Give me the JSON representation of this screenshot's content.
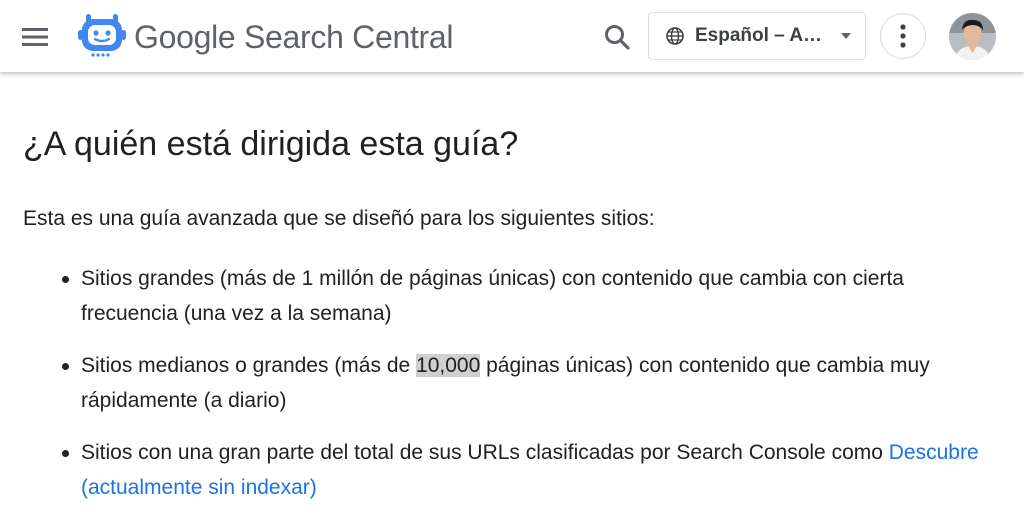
{
  "header": {
    "menu_icon": "hamburger-menu-icon",
    "logo_icon": "search-central-robot-icon",
    "brand_google": "Google",
    "brand_product": "Search Central",
    "search_icon": "search-icon",
    "language_label": "Español – A…",
    "language_icon": "globe-icon",
    "more_icon": "more-vert-icon",
    "accent_color": "#4285f4"
  },
  "article": {
    "heading": "¿A quién está dirigida esta guía?",
    "intro": "Esta es una guía avanzada que se diseñó para los siguientes sitios:",
    "bullets": [
      {
        "text": "Sitios grandes (más de 1 millón de páginas únicas) con contenido que cambia con cierta frecuencia (una vez a la semana)"
      },
      {
        "before": "Sitios medianos o grandes (más de ",
        "highlight": "10,000",
        "after": " páginas únicas) con contenido que cambia muy rápidamente (a diario)"
      },
      {
        "before": "Sitios con una gran parte del total de sus URLs clasificadas por Search Console como ",
        "link": "Descubre (actualmente sin indexar)"
      }
    ],
    "link_color": "#1a73e8"
  }
}
